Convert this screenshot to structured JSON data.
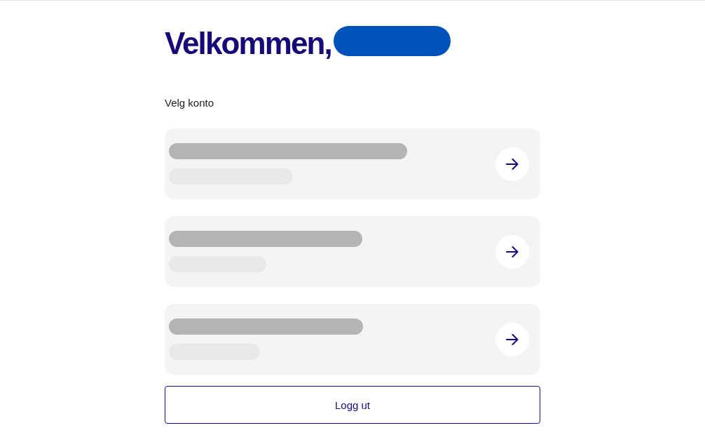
{
  "greeting": {
    "text": "Velkommen,",
    "name_redacted": true
  },
  "section_label": "Velg konto",
  "accounts": [
    {
      "kind": "redacted"
    },
    {
      "kind": "redacted"
    },
    {
      "kind": "redacted"
    }
  ],
  "logout_button": "Logg ut"
}
